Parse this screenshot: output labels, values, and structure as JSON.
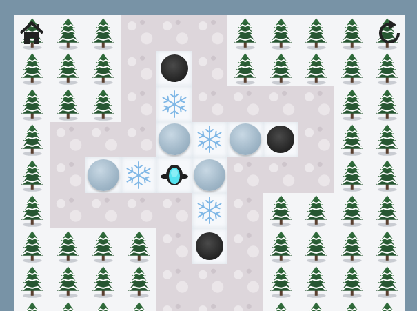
{
  "board": {
    "rows": [
      [
        {
          "kind": "tree"
        },
        {
          "kind": "tree"
        },
        {
          "kind": "tree"
        },
        {
          "kind": "snow"
        },
        {
          "kind": "snow"
        },
        {
          "kind": "snow"
        },
        {
          "kind": "tree"
        },
        {
          "kind": "tree"
        },
        {
          "kind": "tree"
        },
        {
          "kind": "tree"
        },
        {
          "kind": "tree"
        }
      ],
      [
        {
          "kind": "tree"
        },
        {
          "kind": "tree"
        },
        {
          "kind": "tree"
        },
        {
          "kind": "snow"
        },
        {
          "kind": "ice",
          "piece": "hole"
        },
        {
          "kind": "snow"
        },
        {
          "kind": "tree"
        },
        {
          "kind": "tree"
        },
        {
          "kind": "tree"
        },
        {
          "kind": "tree"
        },
        {
          "kind": "tree"
        }
      ],
      [
        {
          "kind": "tree"
        },
        {
          "kind": "tree"
        },
        {
          "kind": "tree"
        },
        {
          "kind": "snow"
        },
        {
          "kind": "ice",
          "piece": "flake"
        },
        {
          "kind": "snow"
        },
        {
          "kind": "snow"
        },
        {
          "kind": "snow"
        },
        {
          "kind": "snow"
        },
        {
          "kind": "tree"
        },
        {
          "kind": "tree"
        }
      ],
      [
        {
          "kind": "tree"
        },
        {
          "kind": "snow"
        },
        {
          "kind": "snow"
        },
        {
          "kind": "snow"
        },
        {
          "kind": "ice",
          "piece": "ball"
        },
        {
          "kind": "ice",
          "piece": "flake"
        },
        {
          "kind": "ice",
          "piece": "ball"
        },
        {
          "kind": "ice",
          "piece": "hole"
        },
        {
          "kind": "snow"
        },
        {
          "kind": "tree"
        },
        {
          "kind": "tree"
        }
      ],
      [
        {
          "kind": "tree"
        },
        {
          "kind": "snow"
        },
        {
          "kind": "ice",
          "piece": "ball"
        },
        {
          "kind": "ice",
          "piece": "flake"
        },
        {
          "kind": "ice",
          "piece": "penguin"
        },
        {
          "kind": "ice",
          "piece": "ball"
        },
        {
          "kind": "snow"
        },
        {
          "kind": "snow"
        },
        {
          "kind": "snow"
        },
        {
          "kind": "tree"
        },
        {
          "kind": "tree"
        }
      ],
      [
        {
          "kind": "tree"
        },
        {
          "kind": "snow"
        },
        {
          "kind": "snow"
        },
        {
          "kind": "snow"
        },
        {
          "kind": "snow"
        },
        {
          "kind": "ice",
          "piece": "flake"
        },
        {
          "kind": "snow"
        },
        {
          "kind": "tree"
        },
        {
          "kind": "tree"
        },
        {
          "kind": "tree"
        },
        {
          "kind": "tree"
        }
      ],
      [
        {
          "kind": "tree"
        },
        {
          "kind": "tree"
        },
        {
          "kind": "tree"
        },
        {
          "kind": "tree"
        },
        {
          "kind": "snow"
        },
        {
          "kind": "ice",
          "piece": "hole"
        },
        {
          "kind": "snow"
        },
        {
          "kind": "tree"
        },
        {
          "kind": "tree"
        },
        {
          "kind": "tree"
        },
        {
          "kind": "tree"
        }
      ],
      [
        {
          "kind": "tree"
        },
        {
          "kind": "tree"
        },
        {
          "kind": "tree"
        },
        {
          "kind": "tree"
        },
        {
          "kind": "snow"
        },
        {
          "kind": "snow"
        },
        {
          "kind": "snow"
        },
        {
          "kind": "tree"
        },
        {
          "kind": "tree"
        },
        {
          "kind": "tree"
        },
        {
          "kind": "tree"
        }
      ],
      [
        {
          "kind": "tree"
        },
        {
          "kind": "tree"
        },
        {
          "kind": "tree"
        },
        {
          "kind": "tree"
        },
        {
          "kind": "snow"
        },
        {
          "kind": "snow"
        },
        {
          "kind": "snow"
        },
        {
          "kind": "tree"
        },
        {
          "kind": "tree"
        },
        {
          "kind": "tree"
        },
        {
          "kind": "tree"
        }
      ]
    ]
  }
}
